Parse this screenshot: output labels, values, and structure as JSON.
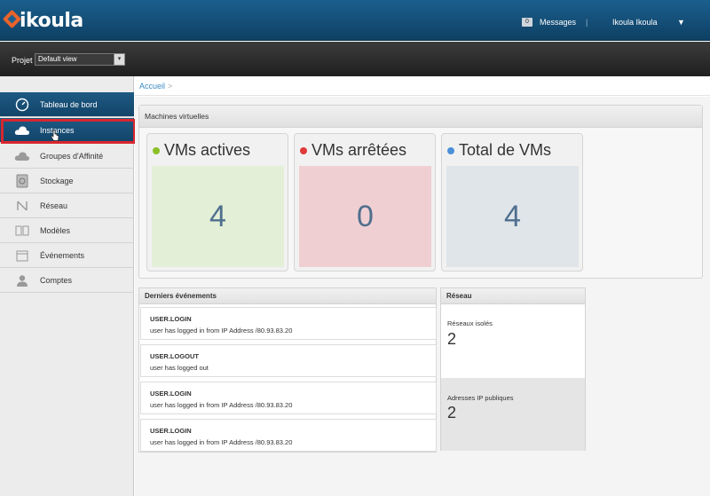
{
  "header": {
    "brand": "ikoula",
    "messages_count": "0",
    "messages_label": "Messages",
    "separator": "|",
    "user_name": "Ikoula Ikoula",
    "user_menu_caret": "▼"
  },
  "project": {
    "label": "Projet",
    "selected": "Default view",
    "select_caret": "▾"
  },
  "sidebar": {
    "items": [
      {
        "label": "Tableau de bord",
        "icon": "dashboard-gauge-icon",
        "active": true
      },
      {
        "label": "Instances",
        "icon": "cloud-icon",
        "active": true
      },
      {
        "label": "Groupes d'Affinité",
        "icon": "affinity-cloud-icon",
        "active": false
      },
      {
        "label": "Stockage",
        "icon": "storage-disk-icon",
        "active": false
      },
      {
        "label": "Réseau",
        "icon": "network-icon",
        "active": false
      },
      {
        "label": "Modèles",
        "icon": "templates-icon",
        "active": false
      },
      {
        "label": "Événements",
        "icon": "calendar-icon",
        "active": false
      },
      {
        "label": "Comptes",
        "icon": "user-icon",
        "active": false
      }
    ]
  },
  "breadcrumb": {
    "home": "Accueil",
    "separator": ">"
  },
  "vm_panel": {
    "title": "Machines virtuelles",
    "cards": [
      {
        "name": "VMs actives",
        "count": "4",
        "dot_color": "#8cbf26",
        "box_color": "#e3efd6"
      },
      {
        "name": "VMs arrêtées",
        "count": "0",
        "dot_color": "#e03a3a",
        "box_color": "#f0cfd3"
      },
      {
        "name": "Total de VMs",
        "count": "4",
        "dot_color": "#4a90d9",
        "box_color": "#e0e5ea"
      }
    ]
  },
  "events": {
    "title": "Derniers événements",
    "items": [
      {
        "type": "USER.LOGIN",
        "description": "user has logged in from IP Address /80.93.83.20"
      },
      {
        "type": "USER.LOGOUT",
        "description": "user has logged out"
      },
      {
        "type": "USER.LOGIN",
        "description": "user has logged in from IP Address /80.93.83.20"
      },
      {
        "type": "USER.LOGIN",
        "description": "user has logged in from IP Address /80.93.83.20"
      }
    ]
  },
  "network": {
    "title": "Réseau",
    "isolated_label": "Réseaux isolés",
    "isolated_value": "2",
    "public_ip_label": "Adresses IP publiques",
    "public_ip_value": "2"
  }
}
